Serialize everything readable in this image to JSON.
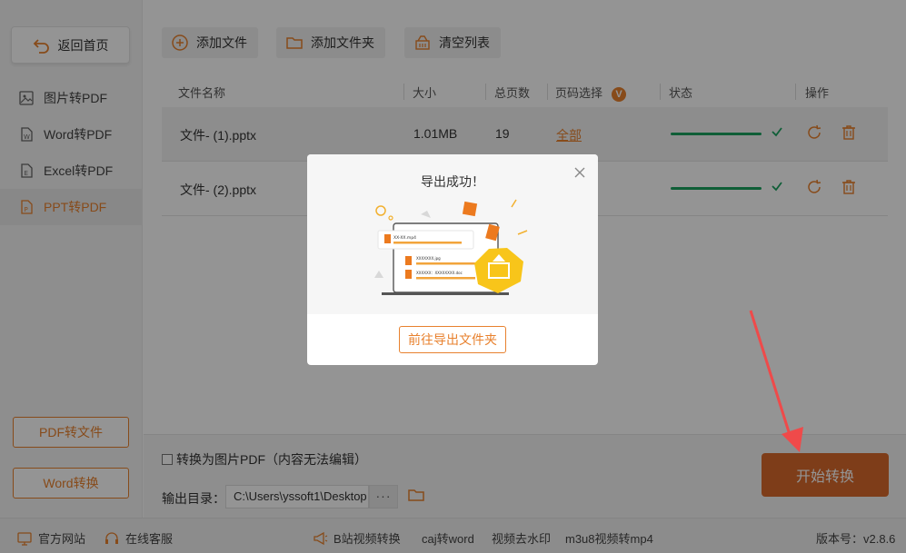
{
  "sidebar": {
    "home_label": "返回首页",
    "items": [
      {
        "label": "图片转PDF",
        "icon": "image-icon",
        "active": false
      },
      {
        "label": "Word转PDF",
        "icon": "word-icon",
        "active": false
      },
      {
        "label": "Excel转PDF",
        "icon": "excel-icon",
        "active": false
      },
      {
        "label": "PPT转PDF",
        "icon": "ppt-icon",
        "active": true
      }
    ],
    "pdf_to_file_label": "PDF转文件",
    "word_convert_label": "Word转换"
  },
  "toolbar": {
    "add_file_label": "添加文件",
    "add_folder_label": "添加文件夹",
    "clear_list_label": "清空列表"
  },
  "table": {
    "headers": {
      "name": "文件名称",
      "size": "大小",
      "pages": "总页数",
      "page_select": "页码选择",
      "page_select_badge": "V",
      "status": "状态",
      "actions": "操作"
    },
    "rows": [
      {
        "name": "文件- (1).pptx",
        "size": "1.01MB",
        "pages": "19",
        "page_select": "全部",
        "progress": 1.0
      },
      {
        "name": "文件- (2).pptx",
        "size": "",
        "pages": "",
        "page_select": "",
        "progress": 1.0
      }
    ]
  },
  "bottom": {
    "image_pdf_label": "转换为图片PDF（内容无法编辑）",
    "output_label": "输出目录：",
    "output_path": "C:\\Users\\yssoft1\\Desktop",
    "more_label": "···",
    "start_label": "开始转换"
  },
  "statusbar": {
    "website_label": "官方网站",
    "service_label": "在线客服",
    "bilibili_label": "B站视频转换",
    "caj_label": "caj转word",
    "watermark_label": "视频去水印",
    "m3u8_label": "m3u8视频转mp4",
    "version_label": "版本号：v2.8.6"
  },
  "modal": {
    "title": "导出成功！",
    "open_folder_label": "前往导出文件夹",
    "art_labels": {
      "item1": "XX-XX.mp4",
      "item2": "XXXXXXX.jpg",
      "item3": "XXXXXX：XXXXXXXX.doc"
    }
  },
  "colors": {
    "accent": "#e8812e",
    "start_button": "#d96a2c",
    "progress": "#1aa35f",
    "arrow": "#ef4a4a"
  }
}
